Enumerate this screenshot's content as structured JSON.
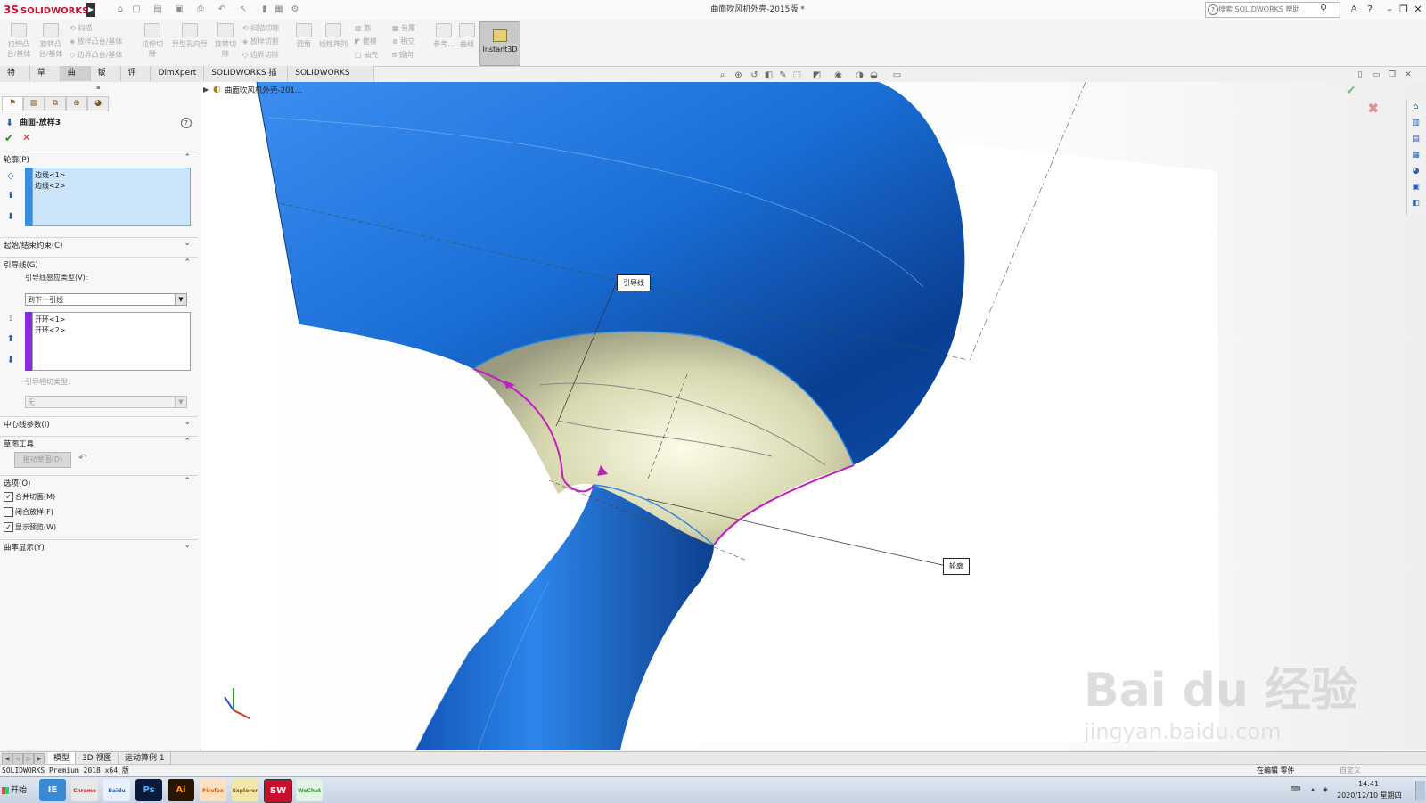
{
  "app": {
    "brand_ds": "3S",
    "brand": "SOLIDWORKS",
    "document_title": "曲面吹风机外壳-2015版 *"
  },
  "search": {
    "placeholder": "搜索 SOLIDWORKS 帮助"
  },
  "command_manager": {
    "extruded_boss": "拉伸凸台/基体",
    "revolved_boss": "旋转凸台/基体",
    "swept_boss": "扫描",
    "lofted_boss": "放样凸台/基体",
    "boundary_boss": "边界凸台/基体",
    "extruded_cut": "拉伸切除",
    "hole_wizard": "异型孔向导",
    "revolved_cut": "旋转切除",
    "swept_cut": "扫描切除",
    "lofted_cut": "放样切割",
    "boundary_cut": "边界切除",
    "fillet": "圆角",
    "linear_pattern": "线性阵列",
    "rib": "筋",
    "draft": "拔模",
    "shell": "抽壳",
    "wrap": "包覆",
    "intersect": "相交",
    "mirror": "镜向",
    "reference_geometry": "参考...",
    "curves": "曲线",
    "instant3d": "Instant3D"
  },
  "tabs": [
    "特征",
    "草图",
    "曲面",
    "钣件",
    "评估",
    "DimXpert",
    "SOLIDWORKS 插件",
    "SOLIDWORKS MBD"
  ],
  "active_tab": 2,
  "property_manager": {
    "title": "曲面-放样3",
    "help": "?",
    "ok": "✔",
    "cancel": "✕",
    "profiles": {
      "header": "轮廓(P)",
      "items": [
        "边线<1>",
        "边线<2>"
      ]
    },
    "start_end": {
      "header": "起始/结束约束(C)"
    },
    "guides": {
      "header": "引导线(G)",
      "type_label": "引导线感应类型(V):",
      "type_value": "到下一引线",
      "items": [
        "开环<1>",
        "开环<2>"
      ],
      "tangency_label": "引导相切类型:",
      "tangency_value": "无"
    },
    "centerline": {
      "header": "中心线参数(I)"
    },
    "sketch_tools": {
      "header": "草图工具",
      "drag_sketch": "拖动草图(D)"
    },
    "options": {
      "header": "选项(O)",
      "merge_tangent": "合并切面(M)",
      "close_loft": "闭合放样(F)",
      "show_preview": "显示预览(W)"
    },
    "curvature_display": {
      "header": "曲率显示(Y)"
    }
  },
  "viewport": {
    "tree_flyout": "曲面吹风机外壳-201...",
    "callout_guide": "引导线",
    "callout_profile": "轮廓"
  },
  "bottom_tabs": [
    "模型",
    "3D 视图",
    "运动算例 1"
  ],
  "status": {
    "left": "SOLIDWORKS Premium 2018 x64 版",
    "editing": "在编辑 零件",
    "units": "自定义"
  },
  "taskbar": {
    "start": "开始",
    "apps": [
      "IE",
      "Chrome",
      "Baidu",
      "Ps",
      "Ai",
      "Firefox",
      "Explorer",
      "SW",
      "WeChat"
    ],
    "time": "14:41",
    "date": "2020/12/10 星期四"
  },
  "watermark": {
    "brand": "Bai du 经验",
    "url": "jingyan.baidu.com"
  },
  "colors": {
    "surface_blue": "#1a6fd6",
    "loft_preview": "#dcdcb0",
    "guide_curve": "#c020c0",
    "selection_blue": "#cde5fb",
    "accent_red": "#c8102e"
  }
}
